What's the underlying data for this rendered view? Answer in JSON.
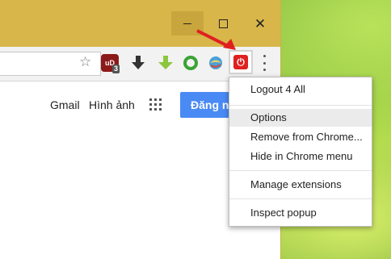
{
  "window": {
    "minimize_icon": "minimize-icon",
    "maximize_icon": "maximize-icon",
    "close_icon": "close-icon"
  },
  "toolbar": {
    "bookmark_icon": "star-icon",
    "extensions": [
      {
        "name": "ublock-extension",
        "badge": "3"
      },
      {
        "name": "download-arrow-extension"
      },
      {
        "name": "green-download-extension"
      },
      {
        "name": "green-ring-extension"
      },
      {
        "name": "globe-extension"
      },
      {
        "name": "logout-power-extension"
      }
    ],
    "menu_icon": "more-vert-icon"
  },
  "google": {
    "gmail": "Gmail",
    "images": "Hình ảnh",
    "signin": "Đăng nhập"
  },
  "context_menu": {
    "items": [
      {
        "label": "Logout 4 All"
      },
      {
        "label": "Options",
        "highlighted": true
      },
      {
        "label": "Remove from Chrome..."
      },
      {
        "label": "Hide in Chrome menu"
      },
      {
        "label": "Manage extensions"
      },
      {
        "label": "Inspect popup"
      }
    ]
  },
  "colors": {
    "titlebar": "#d8b64a",
    "signin_button": "#4a8af4",
    "power_extension": "#e02020",
    "annotation_arrow": "#e02020"
  }
}
